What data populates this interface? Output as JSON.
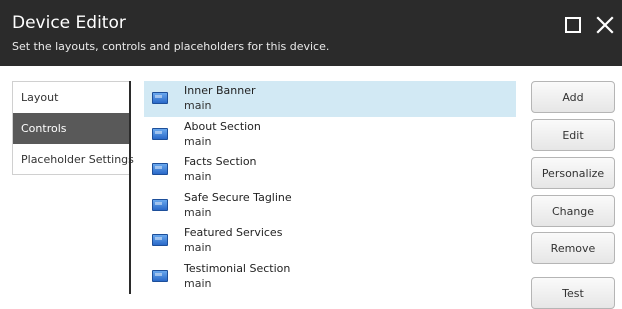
{
  "dialog": {
    "title": "Device Editor",
    "subtitle": "Set the layouts, controls and placeholders for this device."
  },
  "tabs": [
    {
      "label": "Layout",
      "active": false
    },
    {
      "label": "Controls",
      "active": true
    },
    {
      "label": "Placeholder Settings",
      "active": false
    }
  ],
  "controls": [
    {
      "name": "Inner Banner",
      "placeholder": "main",
      "selected": true
    },
    {
      "name": "About Section",
      "placeholder": "main",
      "selected": false
    },
    {
      "name": "Facts Section",
      "placeholder": "main",
      "selected": false
    },
    {
      "name": "Safe Secure Tagline",
      "placeholder": "main",
      "selected": false
    },
    {
      "name": "Featured Services",
      "placeholder": "main",
      "selected": false
    },
    {
      "name": "Testimonial Section",
      "placeholder": "main",
      "selected": false
    }
  ],
  "actions": {
    "add": "Add",
    "edit": "Edit",
    "personalize": "Personalize",
    "change": "Change",
    "remove": "Remove",
    "test": "Test"
  },
  "colors": {
    "header_bg": "#2b2b2b",
    "active_tab_bg": "#595959",
    "selected_row_bg": "#d2e9f4"
  },
  "icons": {
    "maximize": "maximize-icon",
    "close": "close-icon",
    "control": "rendering-icon"
  }
}
